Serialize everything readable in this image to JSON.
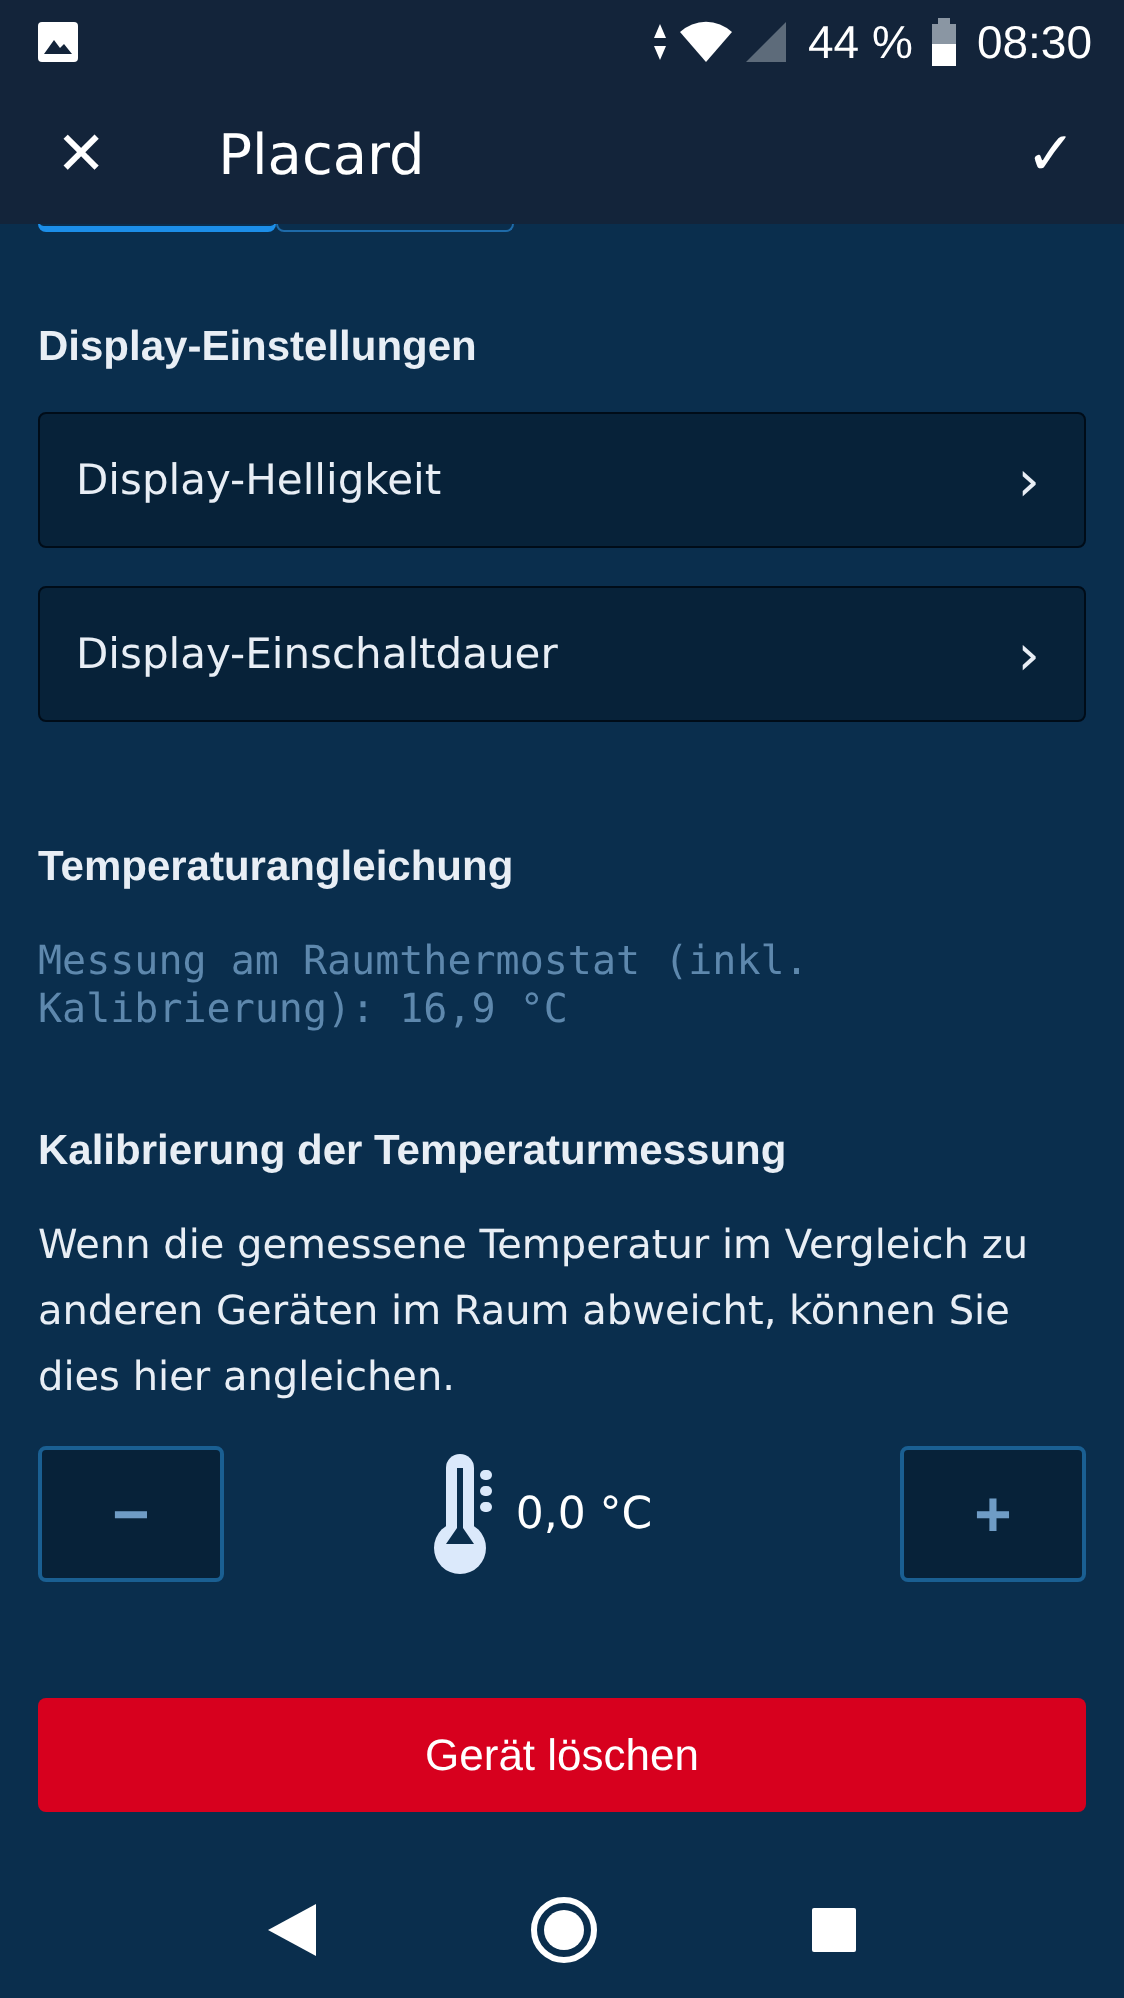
{
  "status_bar": {
    "battery": "44 %",
    "time": "08:30"
  },
  "app_bar": {
    "close": "✕",
    "title": "Placard",
    "confirm": "✓"
  },
  "segments": [
    {
      "selected": true
    },
    {
      "selected": false
    }
  ],
  "display_section": {
    "heading": "Display-Einstellungen",
    "items": [
      {
        "label": "Display-Helligkeit",
        "chevron": "›"
      },
      {
        "label": "Display-Einschaltdauer",
        "chevron": "›"
      }
    ]
  },
  "temperature_section": {
    "heading": "Temperaturangleichung",
    "info": "Messung am Raumthermostat (inkl. Kalibrierung): 16,9 °C"
  },
  "calibration_section": {
    "heading": "Kalibrierung der Temperaturmessung",
    "description": "Wenn die gemessene Temperatur im Vergleich zu anderen Geräten im Raum abweicht, können Sie dies hier angleichen.",
    "decrease": "−",
    "value": "0,0 °C",
    "increase": "+"
  },
  "delete_button": "Gerät löschen"
}
